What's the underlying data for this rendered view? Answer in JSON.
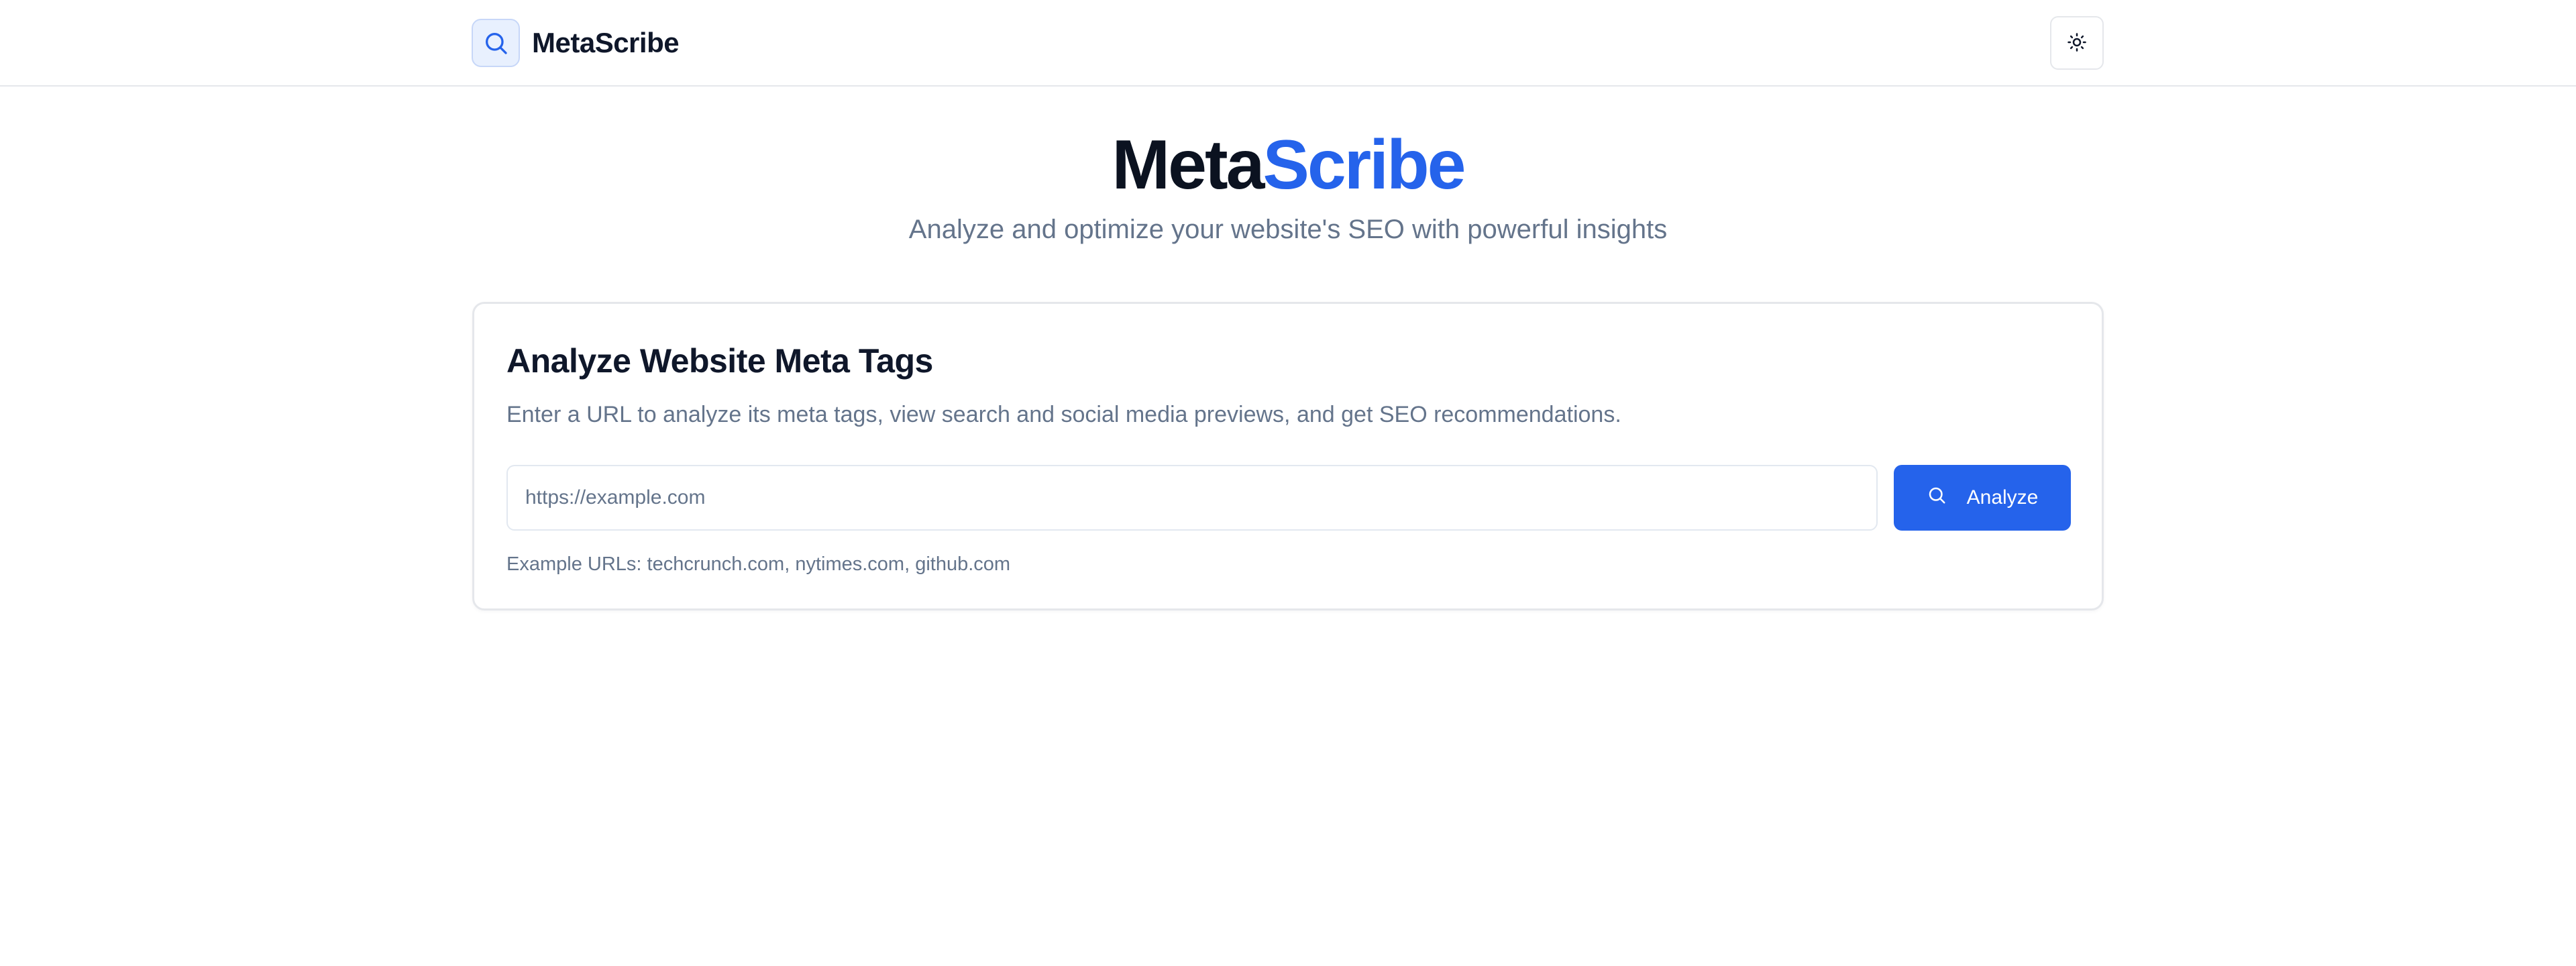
{
  "header": {
    "brand_name": "MetaScribe",
    "logo_icon": "search-icon",
    "theme_toggle_icon": "sun-icon"
  },
  "hero": {
    "title_part1": "Meta",
    "title_part2": "Scribe",
    "subtitle": "Analyze and optimize your website's SEO with powerful insights"
  },
  "card": {
    "title": "Analyze Website Meta Tags",
    "description": "Enter a URL to analyze its meta tags, view search and social media previews, and get SEO recommendations.",
    "url_input": {
      "value": "",
      "placeholder": "https://example.com"
    },
    "analyze_button": {
      "label": "Analyze",
      "icon": "search-icon"
    },
    "examples_text": "Example URLs: techcrunch.com, nytimes.com, github.com"
  },
  "colors": {
    "accent": "#2563eb",
    "text_primary": "#0f172a",
    "text_muted": "#64748b",
    "border": "#e5e7eb",
    "logo_bg": "#e8f0fe"
  }
}
